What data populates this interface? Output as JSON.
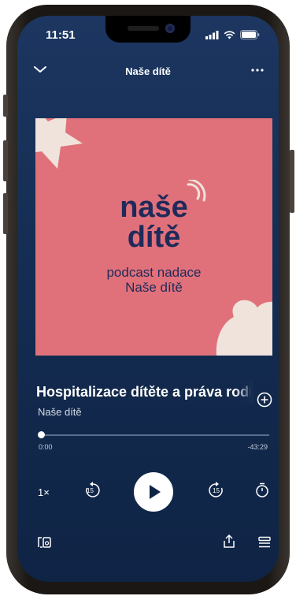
{
  "status_bar": {
    "time": "11:51"
  },
  "header": {
    "title": "Naše dítě"
  },
  "artwork": {
    "title_line1": "naše",
    "title_line2": "dítě",
    "subtitle_line1": "podcast nadace",
    "subtitle_line2": "Naše dítě"
  },
  "episode": {
    "title": "Hospitalizace dítěte a práva rodičů",
    "show": "Naše dítě"
  },
  "player": {
    "elapsed": "0:00",
    "remaining": "-43:29",
    "progress": 0.0,
    "speed": "1×",
    "skip_back_seconds": "15",
    "skip_forward_seconds": "15"
  },
  "colors": {
    "background_top": "#1c3661",
    "background_bottom": "#0f2445",
    "artwork_bg": "#e0717a",
    "artwork_text": "#1f2a5a",
    "artwork_shape": "#efe3db"
  }
}
